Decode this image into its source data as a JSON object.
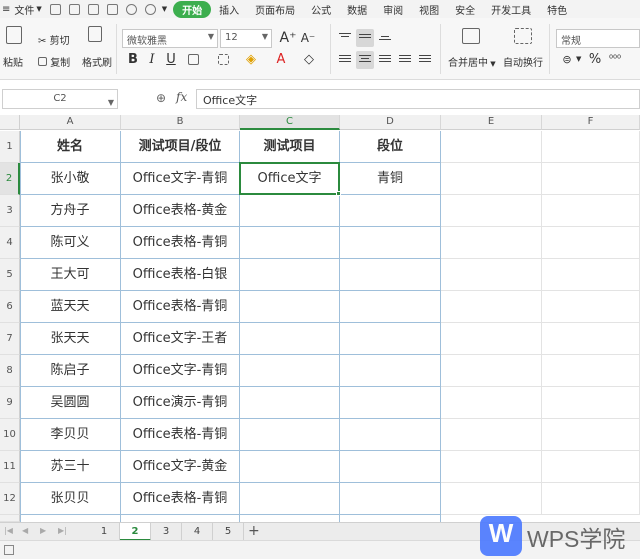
{
  "menubar": {
    "file": "文件",
    "tabs": [
      {
        "label": "开始",
        "active": true
      },
      {
        "label": "插入"
      },
      {
        "label": "页面布局"
      },
      {
        "label": "公式"
      },
      {
        "label": "数据"
      },
      {
        "label": "审阅"
      },
      {
        "label": "视图"
      },
      {
        "label": "安全"
      },
      {
        "label": "开发工具"
      },
      {
        "label": "特色"
      }
    ]
  },
  "ribbon": {
    "paste": "粘贴",
    "cut": "剪切",
    "copy": "复制",
    "format_painter": "格式刷",
    "font_name": "微软雅黑",
    "font_size": "12",
    "bold": "B",
    "italic": "I",
    "underline": "U",
    "font_color_glyph": "A",
    "grow_font": "A⁺",
    "shrink_font": "A⁻",
    "merge_center": "合并居中",
    "wrap_text": "自动换行",
    "number_format": "常规",
    "percent": "%",
    "comma": "⁰⁰⁰"
  },
  "formula_bar": {
    "name_box": "C2",
    "fx": "fx",
    "content": "Office文字"
  },
  "columns": [
    "A",
    "B",
    "C",
    "D",
    "E",
    "F"
  ],
  "rows": [
    "1",
    "2",
    "3",
    "4",
    "5",
    "6",
    "7",
    "8",
    "9",
    "10",
    "11",
    "12"
  ],
  "table": {
    "headers": [
      "姓名",
      "测试项目/段位",
      "测试项目",
      "段位"
    ],
    "data": [
      [
        "张小敬",
        "Office文字-青铜",
        "Office文字",
        "青铜"
      ],
      [
        "方舟子",
        "Office表格-黄金",
        "",
        ""
      ],
      [
        "陈可义",
        "Office表格-青铜",
        "",
        ""
      ],
      [
        "王大可",
        "Office表格-白银",
        "",
        ""
      ],
      [
        "蓝天天",
        "Office表格-青铜",
        "",
        ""
      ],
      [
        "张天天",
        "Office文字-王者",
        "",
        ""
      ],
      [
        "陈启子",
        "Office文字-青铜",
        "",
        ""
      ],
      [
        "吴圆圆",
        "Office演示-青铜",
        "",
        ""
      ],
      [
        "李贝贝",
        "Office表格-青铜",
        "",
        ""
      ],
      [
        "苏三十",
        "Office文字-黄金",
        "",
        ""
      ],
      [
        "张贝贝",
        "Office表格-青铜",
        "",
        ""
      ]
    ]
  },
  "sheets": {
    "tabs": [
      "1",
      "2",
      "3",
      "4",
      "5"
    ],
    "active": "2",
    "add": "+"
  },
  "watermark": {
    "logo_letter": "W",
    "text": "WPS学院"
  },
  "colors": {
    "accent_green": "#2b8a3e",
    "tab_green": "#3cae4e",
    "border_blue": "#9fbfda",
    "wps_blue": "#4e7bff"
  }
}
